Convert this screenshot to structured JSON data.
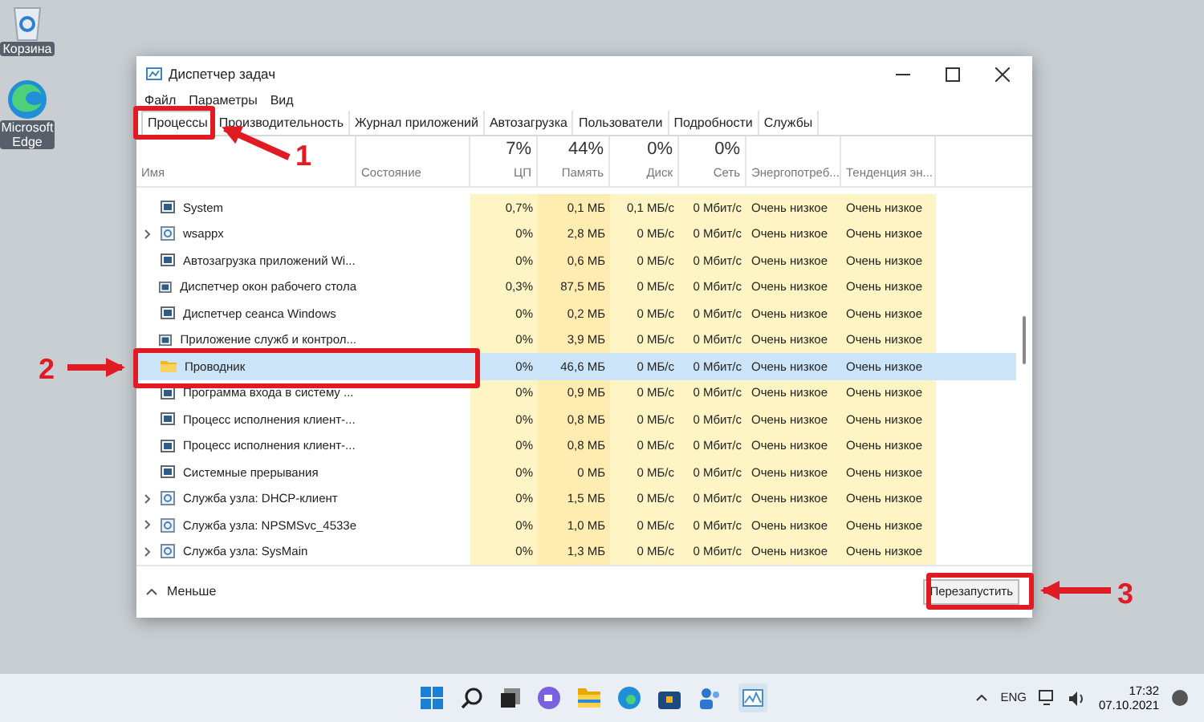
{
  "desktop_icons": [
    {
      "kind": "recycle",
      "label": "Корзина"
    },
    {
      "kind": "edge",
      "label": "Microsoft Edge"
    }
  ],
  "window": {
    "title": "Диспетчер задач"
  },
  "menu": [
    "Файл",
    "Параметры",
    "Вид"
  ],
  "tabs": [
    {
      "label": "Процессы",
      "selected": true
    },
    {
      "label": "Производительность",
      "selected": false
    },
    {
      "label": "Журнал приложений",
      "selected": false
    },
    {
      "label": "Автозагрузка",
      "selected": false
    },
    {
      "label": "Пользователи",
      "selected": false
    },
    {
      "label": "Подробности",
      "selected": false
    },
    {
      "label": "Службы",
      "selected": false
    }
  ],
  "table": {
    "columns": [
      {
        "label": "Имя"
      },
      {
        "label": "Состояние"
      },
      {
        "total": "7%",
        "label": "ЦП"
      },
      {
        "total": "44%",
        "label": "Память"
      },
      {
        "total": "0%",
        "label": "Диск"
      },
      {
        "total": "0%",
        "label": "Сеть"
      },
      {
        "label": "Энергопотреб..."
      },
      {
        "label": "Тенденция эн..."
      }
    ],
    "rows": [
      {
        "name": "System",
        "expandable": false,
        "kind": "window",
        "selected": false,
        "cpu": "0,7%",
        "memory": "0,1 МБ",
        "disk": "0,1 МБ/с",
        "network": "0 Мбит/с",
        "power": "Очень низкое",
        "trend": "Очень низкое"
      },
      {
        "name": "wsappx",
        "expandable": true,
        "kind": "service",
        "selected": false,
        "cpu": "0%",
        "memory": "2,8 МБ",
        "disk": "0 МБ/с",
        "network": "0 Мбит/с",
        "power": "Очень низкое",
        "trend": "Очень низкое"
      },
      {
        "name": "Автозагрузка приложений Wi...",
        "expandable": false,
        "kind": "window",
        "selected": false,
        "cpu": "0%",
        "memory": "0,6 МБ",
        "disk": "0 МБ/с",
        "network": "0 Мбит/с",
        "power": "Очень низкое",
        "trend": "Очень низкое"
      },
      {
        "name": "Диспетчер окон рабочего стола",
        "expandable": false,
        "kind": "window",
        "selected": false,
        "cpu": "0,3%",
        "memory": "87,5 МБ",
        "disk": "0 МБ/с",
        "network": "0 Мбит/с",
        "power": "Очень низкое",
        "trend": "Очень низкое"
      },
      {
        "name": "Диспетчер сеанса  Windows",
        "expandable": false,
        "kind": "window",
        "selected": false,
        "cpu": "0%",
        "memory": "0,2 МБ",
        "disk": "0 МБ/с",
        "network": "0 Мбит/с",
        "power": "Очень низкое",
        "trend": "Очень низкое"
      },
      {
        "name": "Приложение служб и контрол...",
        "expandable": false,
        "kind": "window",
        "selected": false,
        "cpu": "0%",
        "memory": "3,9 МБ",
        "disk": "0 МБ/с",
        "network": "0 Мбит/с",
        "power": "Очень низкое",
        "trend": "Очень низкое"
      },
      {
        "name": "Проводник",
        "expandable": false,
        "kind": "folder",
        "selected": true,
        "cpu": "0%",
        "memory": "46,6 МБ",
        "disk": "0 МБ/с",
        "network": "0 Мбит/с",
        "power": "Очень низкое",
        "trend": "Очень низкое"
      },
      {
        "name": "Программа входа в систему ...",
        "expandable": false,
        "kind": "window",
        "selected": false,
        "cpu": "0%",
        "memory": "0,9 МБ",
        "disk": "0 МБ/с",
        "network": "0 Мбит/с",
        "power": "Очень низкое",
        "trend": "Очень низкое"
      },
      {
        "name": "Процесс исполнения клиент-...",
        "expandable": false,
        "kind": "window",
        "selected": false,
        "cpu": "0%",
        "memory": "0,8 МБ",
        "disk": "0 МБ/с",
        "network": "0 Мбит/с",
        "power": "Очень низкое",
        "trend": "Очень низкое"
      },
      {
        "name": "Процесс исполнения клиент-...",
        "expandable": false,
        "kind": "window",
        "selected": false,
        "cpu": "0%",
        "memory": "0,8 МБ",
        "disk": "0 МБ/с",
        "network": "0 Мбит/с",
        "power": "Очень низкое",
        "trend": "Очень низкое"
      },
      {
        "name": "Системные прерывания",
        "expandable": false,
        "kind": "window",
        "selected": false,
        "cpu": "0%",
        "memory": "0 МБ",
        "disk": "0 МБ/с",
        "network": "0 Мбит/с",
        "power": "Очень низкое",
        "trend": "Очень низкое"
      },
      {
        "name": "Служба узла: DHCP-клиент",
        "expandable": true,
        "kind": "service",
        "selected": false,
        "cpu": "0%",
        "memory": "1,5 МБ",
        "disk": "0 МБ/с",
        "network": "0 Мбит/с",
        "power": "Очень низкое",
        "trend": "Очень низкое"
      },
      {
        "name": "Служба узла: NPSMSvc_4533e",
        "expandable": true,
        "kind": "service",
        "selected": false,
        "cpu": "0%",
        "memory": "1,0 МБ",
        "disk": "0 МБ/с",
        "network": "0 Мбит/с",
        "power": "Очень низкое",
        "trend": "Очень низкое"
      },
      {
        "name": "Служба узла: SysMain",
        "expandable": true,
        "kind": "service",
        "selected": false,
        "cpu": "0%",
        "memory": "1,3 МБ",
        "disk": "0 МБ/с",
        "network": "0 Мбит/с",
        "power": "Очень низкое",
        "trend": "Очень низкое"
      }
    ]
  },
  "footer": {
    "less": "Меньше",
    "button": "Перезапустить"
  },
  "annotations": [
    "1",
    "2",
    "3"
  ],
  "tray": {
    "language": "ENG",
    "time": "17:32",
    "date": "07.10.2021"
  }
}
